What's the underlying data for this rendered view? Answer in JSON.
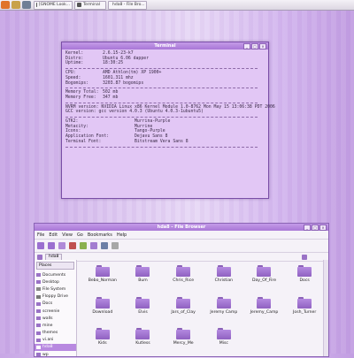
{
  "panel": {
    "tasks": [
      {
        "label": "[GNOME Look..."
      },
      {
        "label": "Terminal"
      },
      {
        "label": "hda8 - File Bro..."
      }
    ]
  },
  "terminal": {
    "title": "Terminal",
    "system": [
      {
        "k": "Kernel:",
        "v": "2.6.15-23-k7"
      },
      {
        "k": "Distro:",
        "v": "Ubuntu 6.06 dapper"
      },
      {
        "k": "Uptime:",
        "v": "18:30:25"
      }
    ],
    "cpu": [
      {
        "k": "CPU:",
        "v": "AMD Athlon(tm) XP 1900+"
      },
      {
        "k": "Speed:",
        "v": "1601.311 mhz"
      },
      {
        "k": "Bogomips:",
        "v": "3203.87 bogomips"
      }
    ],
    "memory": [
      {
        "k": "Memory Total:",
        "v": "502 mb"
      },
      {
        "k": "Memory Free:",
        "v": "347 mb"
      }
    ],
    "versions": [
      "NVRM version: NVIDIA Linux x86 Kernel Module  1.0-8762  Mon May 15 13:06:38 PDT 2006",
      "GCC version:  gcc version 4.0.3 (Ubuntu 4.0.3-1ubuntu5)"
    ],
    "theme": [
      {
        "k": "GTK2:",
        "v": "Murrina-Purple"
      },
      {
        "k": "Metacity:",
        "v": "Murrine"
      },
      {
        "k": "Icons:",
        "v": "Tango-Purple"
      },
      {
        "k": "Application Font:",
        "v": "Dejavu Sans 8"
      },
      {
        "k": "Terminal Font:",
        "v": "Bitstream Vera Sans 8"
      }
    ]
  },
  "filebrowser": {
    "title": "hda8 - File Browser",
    "menu": [
      "File",
      "Edit",
      "View",
      "Go",
      "Bookmarks",
      "Help"
    ],
    "places_label": "Places",
    "places": [
      "Documents",
      "Desktop",
      "File System",
      "Floppy Drive",
      "Docs",
      "screenie",
      "walls",
      "mine",
      "themes",
      "vi.ani",
      "hda8",
      "wp"
    ],
    "selected_place": "hda8",
    "folders": [
      "Bebo_Norman",
      "Bum",
      "Chris_Rice",
      "Christian",
      "Day_Of_Fire",
      "Docs",
      "Download",
      "Elvis",
      "Jars_of_Clay",
      "Jeremy Camp",
      "Jeremy_Camp",
      "Josh_Turner",
      "Kids",
      "Kutless",
      "Mercy_Me",
      "Misc"
    ]
  },
  "colors": {
    "accent": "#a877d6",
    "folder": "#9a6ccb",
    "terminal_bg": "#e2c7f5"
  }
}
